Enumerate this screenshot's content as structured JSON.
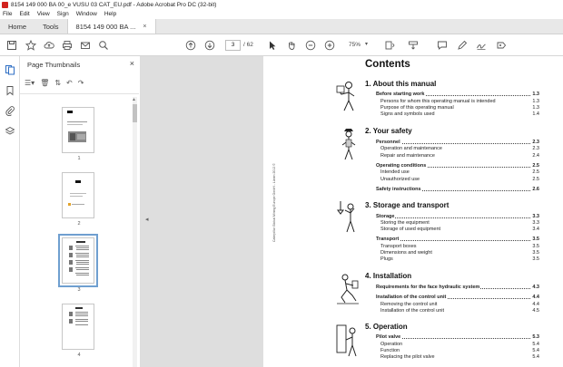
{
  "window": {
    "title": "8154 149 000 BA 00_e VUSU 03 CAT_EU.pdf - Adobe Acrobat Pro DC (32-bit)"
  },
  "menu": [
    "File",
    "Edit",
    "View",
    "Sign",
    "Window",
    "Help"
  ],
  "tabs": {
    "home": "Home",
    "tools": "Tools",
    "doc": "8154 149 000 BA ...",
    "doc_close": "×"
  },
  "toolbar": {
    "page_current": "3",
    "page_total": "/ 62",
    "zoom": "75%"
  },
  "thumbnails": {
    "title": "Page Thumbnails",
    "close": "×",
    "pages": [
      "1",
      "2",
      "3",
      "4"
    ],
    "selected_page": 3
  },
  "document": {
    "side_text": "Caterpillar Global Mining Europe GmbH - Lünen 2012 ©",
    "title": "Contents",
    "sections": [
      {
        "heading": "1. About this manual",
        "entries": [
          {
            "label": "Before starting work",
            "page": "1.3",
            "bold": true
          },
          {
            "label": "Persons for whom this operating manual is intended",
            "page": "1.3",
            "bold": false
          },
          {
            "label": "Purpose of this operating manual",
            "page": "1.3",
            "bold": false
          },
          {
            "label": "Signs and symbols used",
            "page": "1.4",
            "bold": false
          }
        ]
      },
      {
        "heading": "2. Your safety",
        "entries": [
          {
            "label": "Personnel",
            "page": "2.3",
            "bold": true
          },
          {
            "label": "Operation and maintenance",
            "page": "2.3",
            "bold": false
          },
          {
            "label": "Repair and maintenance",
            "page": "2.4",
            "bold": false
          },
          {
            "label": "Operating conditions",
            "page": "2.5",
            "bold": true
          },
          {
            "label": "Intended use",
            "page": "2.5",
            "bold": false
          },
          {
            "label": "Unauthorized use",
            "page": "2.5",
            "bold": false
          },
          {
            "label": "Safety instructions",
            "page": "2.6",
            "bold": true
          }
        ]
      },
      {
        "heading": "3. Storage and transport",
        "entries": [
          {
            "label": "Storage",
            "page": "3.3",
            "bold": true
          },
          {
            "label": "Storing the equipment",
            "page": "3.3",
            "bold": false
          },
          {
            "label": "Storage of used equipment",
            "page": "3.4",
            "bold": false
          },
          {
            "label": "Transport",
            "page": "3.5",
            "bold": true
          },
          {
            "label": "Transport boxes",
            "page": "3.5",
            "bold": false
          },
          {
            "label": "Dimensions and weight",
            "page": "3.5",
            "bold": false
          },
          {
            "label": "Plugs",
            "page": "3.5",
            "bold": false
          }
        ]
      },
      {
        "heading": "4. Installation",
        "entries": [
          {
            "label": "Requirements for the face hydraulic system",
            "page": "4.3",
            "bold": true
          },
          {
            "label": "Installation of the control unit",
            "page": "4.4",
            "bold": true
          },
          {
            "label": "Removing the control unit",
            "page": "4.4",
            "bold": false
          },
          {
            "label": "Installation of the control unit",
            "page": "4.5",
            "bold": false
          }
        ]
      },
      {
        "heading": "5. Operation",
        "entries": [
          {
            "label": "Pilot valve",
            "page": "5.3",
            "bold": true
          },
          {
            "label": "Operation",
            "page": "5.4",
            "bold": false
          },
          {
            "label": "Function",
            "page": "5.4",
            "bold": false
          },
          {
            "label": "Replacing the pilot valve",
            "page": "5.4",
            "bold": false
          }
        ]
      }
    ]
  }
}
